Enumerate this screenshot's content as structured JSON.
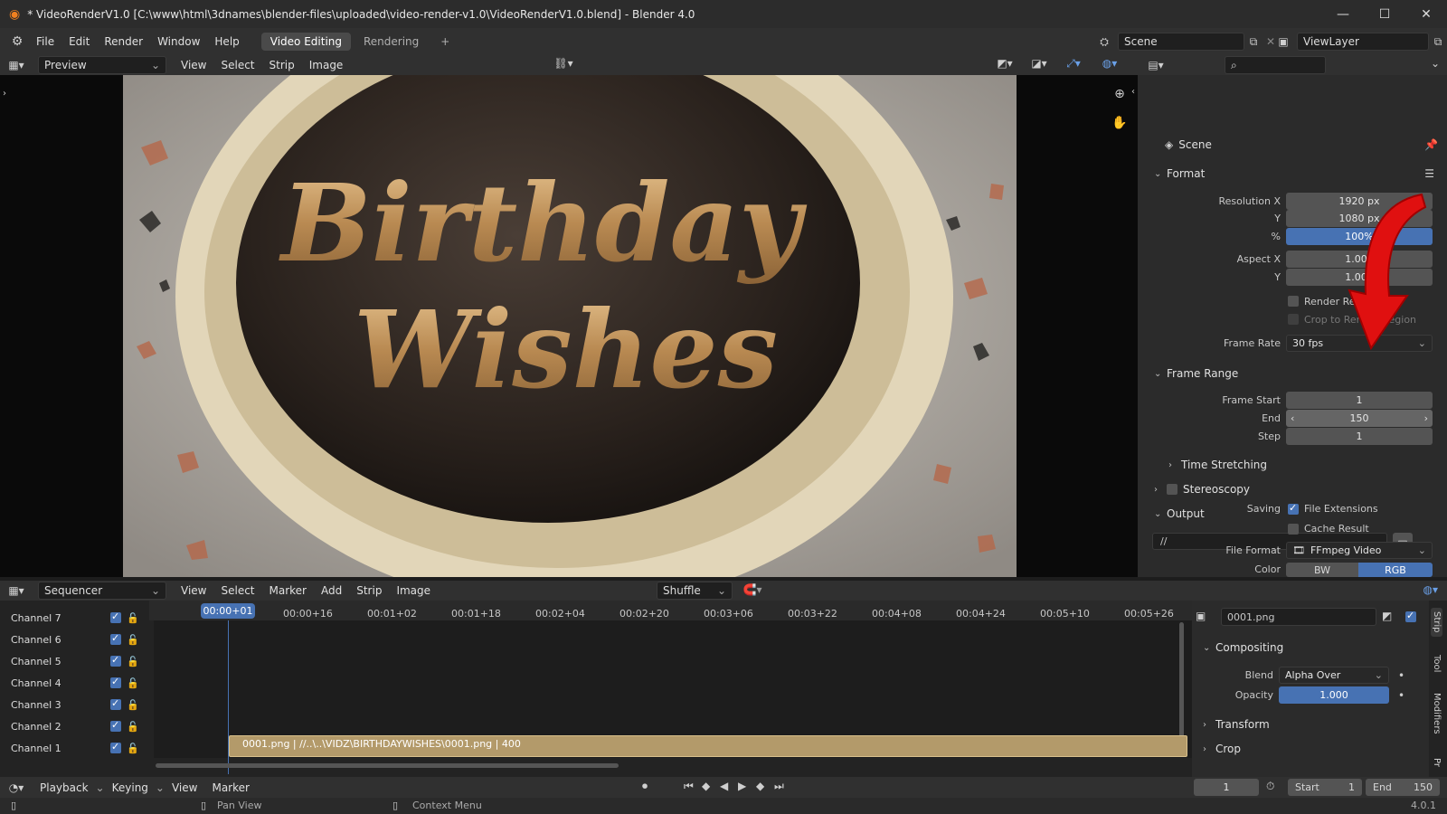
{
  "window": {
    "title": "* VideoRenderV1.0 [C:\\www\\html\\3dnames\\blender-files\\uploaded\\video-render-v1.0\\VideoRenderV1.0.blend] - Blender 4.0",
    "minimize": "—",
    "maximize": "☐",
    "close": "✕"
  },
  "menu": {
    "items": [
      "File",
      "Edit",
      "Render",
      "Window",
      "Help"
    ],
    "workspaces": [
      "Video Editing",
      "Rendering"
    ],
    "add_workspace": "+",
    "scene": "Scene",
    "view_layer": "ViewLayer"
  },
  "preview_header": {
    "mode": "Preview",
    "menus": [
      "View",
      "Select",
      "Strip",
      "Image"
    ]
  },
  "preview_image": {
    "line1": "Birthday",
    "line2": "Wishes"
  },
  "properties": {
    "breadcrumb": "Scene",
    "format_title": "Format",
    "resolution_x_label": "Resolution X",
    "resolution_x": "1920 px",
    "resolution_y_label": "Y",
    "resolution_y": "1080 px",
    "percent_label": "%",
    "percent": "100%",
    "aspect_x_label": "Aspect X",
    "aspect_x": "1.000",
    "aspect_y_label": "Y",
    "aspect_y": "1.000",
    "render_region": "Render Region",
    "crop_region": "Crop to Render Region",
    "frame_rate_label": "Frame Rate",
    "frame_rate": "30 fps",
    "frame_range_title": "Frame Range",
    "frame_start_label": "Frame Start",
    "frame_start": "1",
    "end_label": "End",
    "end": "150",
    "step_label": "Step",
    "step": "1",
    "time_stretching": "Time Stretching",
    "stereoscopy": "Stereoscopy",
    "output_title": "Output",
    "output_path": "//",
    "saving_label": "Saving",
    "file_extensions": "File Extensions",
    "cache_result": "Cache Result",
    "file_format_label": "File Format",
    "file_format": "FFmpeg Video",
    "color_label": "Color",
    "color_bw": "BW",
    "color_rgb": "RGB"
  },
  "sequencer_header": {
    "mode": "Sequencer",
    "menus": [
      "View",
      "Select",
      "Marker",
      "Add",
      "Strip",
      "Image"
    ],
    "shuffle": "Shuffle"
  },
  "timeline": {
    "ticks": [
      "00:00+01",
      "00:00+16",
      "00:01+02",
      "00:01+18",
      "00:02+04",
      "00:02+20",
      "00:03+06",
      "00:03+22",
      "00:04+08",
      "00:04+24",
      "00:05+10",
      "00:05+26"
    ],
    "channels": [
      "Channel 7",
      "Channel 6",
      "Channel 5",
      "Channel 4",
      "Channel 3",
      "Channel 2",
      "Channel 1"
    ],
    "strip_label": "0001.png | //..\\..\\VIDZ\\BIRTHDAYWISHES\\0001.png | 400"
  },
  "strip_props": {
    "name": "0001.png",
    "compositing": "Compositing",
    "blend_label": "Blend",
    "blend": "Alpha Over",
    "opacity_label": "Opacity",
    "opacity": "1.000",
    "transform": "Transform",
    "crop": "Crop",
    "tabs": [
      "Strip",
      "Tool",
      "Modifiers",
      "Pr"
    ]
  },
  "playback": {
    "playback": "Playback",
    "keying": "Keying",
    "view": "View",
    "marker": "Marker",
    "current_frame": "1",
    "start_label": "Start",
    "start": "1",
    "end_label": "End",
    "end": "150"
  },
  "status": {
    "pan_view": "Pan View",
    "context_menu": "Context Menu",
    "version": "4.0.1"
  },
  "colors": {
    "accent": "#4772b3",
    "strip": "#b39a6a",
    "arrow": "#e01010"
  }
}
